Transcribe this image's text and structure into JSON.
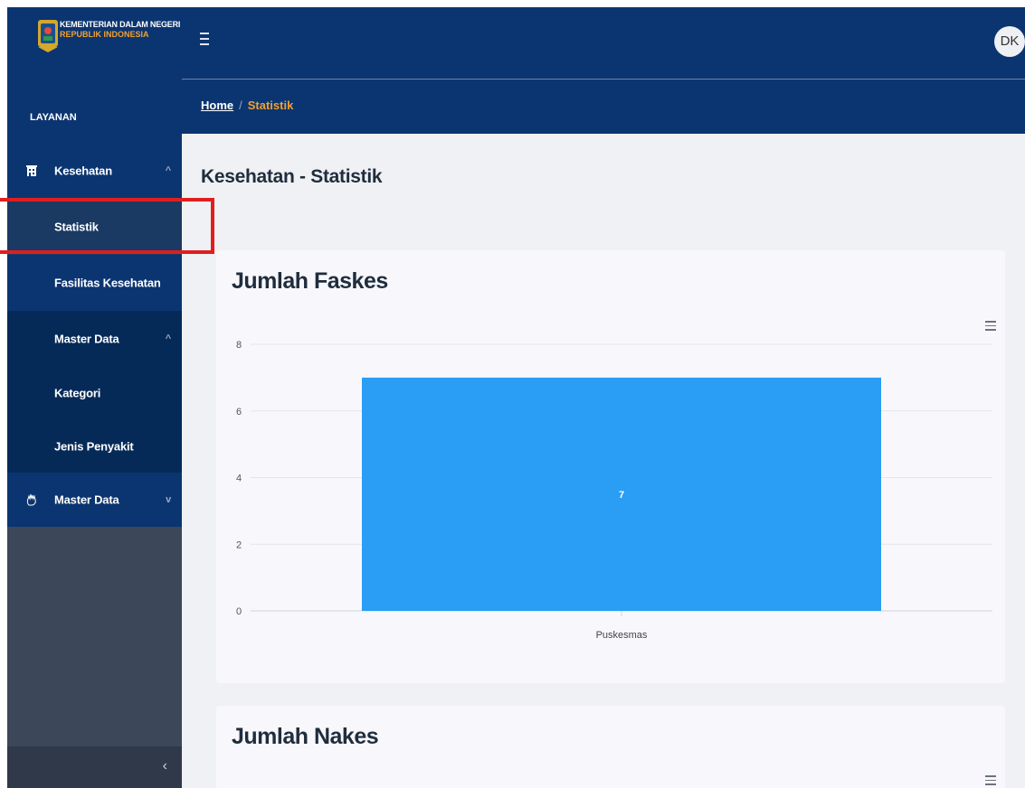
{
  "brand": {
    "line1": "KEMENTERIAN DALAM NEGERI",
    "line2": "REPUBLIK INDONESIA"
  },
  "sidebar": {
    "section_label": "LAYANAN",
    "items": [
      {
        "label": "Kesehatan",
        "icon": "building-icon",
        "chevron": "^"
      },
      {
        "label": "Statistik",
        "active": true
      },
      {
        "label": "Fasilitas Kesehatan"
      },
      {
        "label": "Master Data",
        "chevron": "^"
      },
      {
        "label": "Kategori"
      },
      {
        "label": "Jenis Penyakit"
      },
      {
        "label": "Master Data",
        "icon": "hand-icon",
        "chevron": "v"
      }
    ],
    "collapse_label": "‹"
  },
  "header": {
    "avatar_initials": "DK"
  },
  "breadcrumb": {
    "home": "Home",
    "separator": "/",
    "current": "Statistik"
  },
  "main": {
    "page_title": "Kesehatan - Statistik",
    "cards": [
      {
        "title": "Jumlah Faskes"
      },
      {
        "title": "Jumlah Nakes"
      }
    ]
  },
  "chart_data": {
    "type": "bar",
    "title": "Jumlah Faskes",
    "categories": [
      "Puskesmas"
    ],
    "values": [
      7
    ],
    "ylim": [
      0,
      8
    ],
    "yticks": [
      0,
      2,
      4,
      6,
      8
    ],
    "data_labels": [
      "7"
    ],
    "bar_color": "#2a9df4",
    "grid": true
  },
  "colors": {
    "primary": "#0b3570",
    "accent": "#f0a030",
    "bar": "#2a9df4",
    "highlight": "#e01e1e"
  }
}
